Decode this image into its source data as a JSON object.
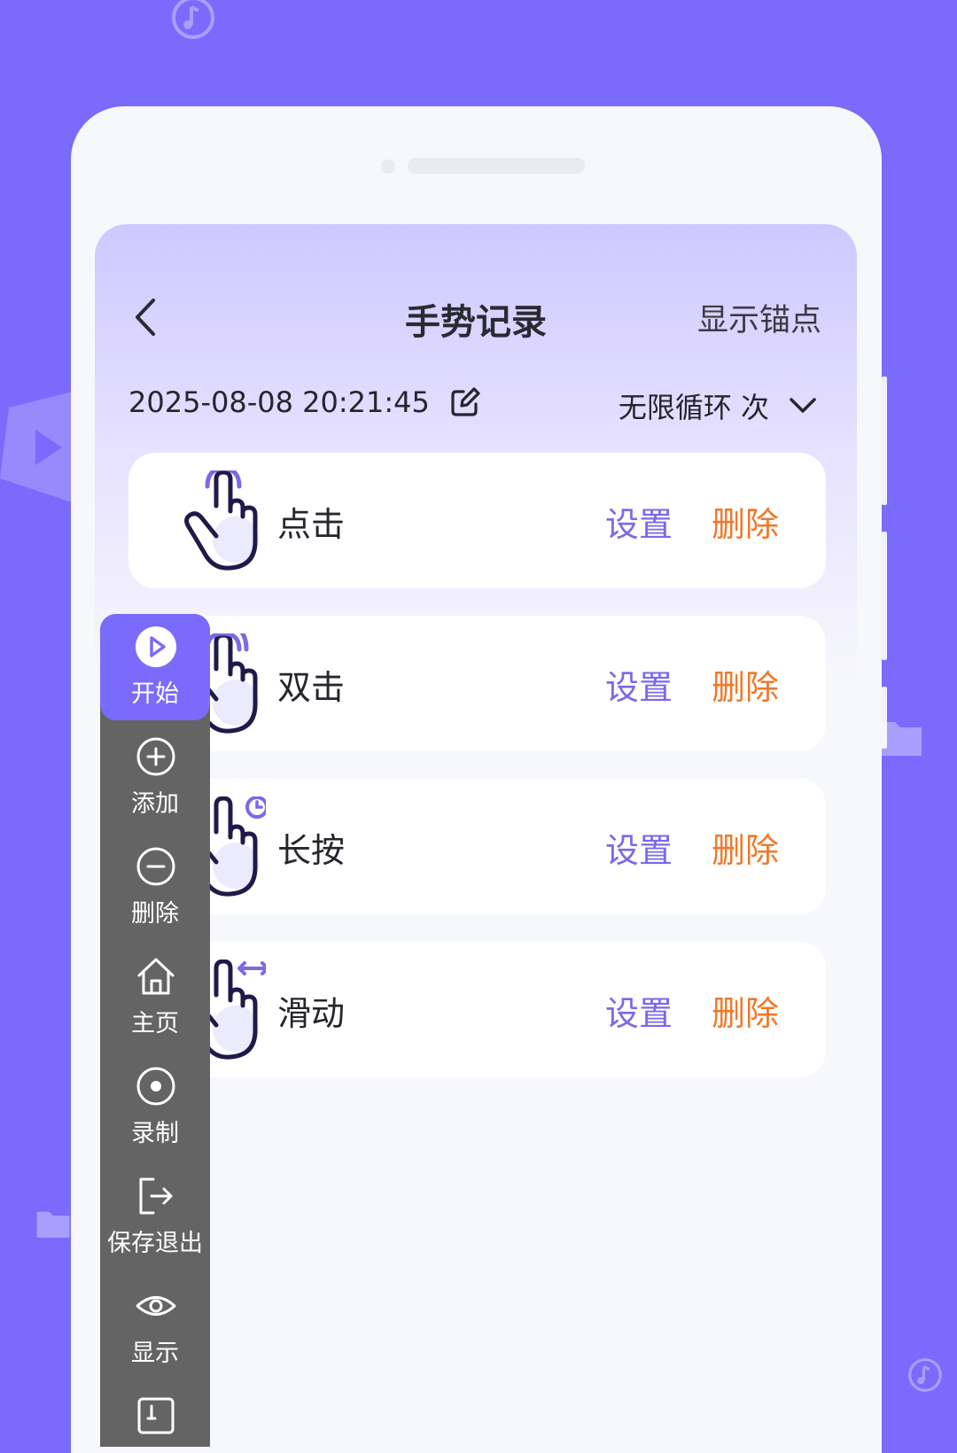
{
  "header": {
    "title": "手势记录",
    "right_action": "显示锚点"
  },
  "recording": {
    "datetime": "2025-08-08 20:21:45",
    "loop_label": "无限循环 次"
  },
  "gestures": [
    {
      "label": "点击",
      "set": "设置",
      "delete": "删除"
    },
    {
      "label": "双击",
      "set": "设置",
      "delete": "删除"
    },
    {
      "label": "长按",
      "set": "设置",
      "delete": "删除"
    },
    {
      "label": "滑动",
      "set": "设置",
      "delete": "删除"
    }
  ],
  "toolbar": {
    "items": [
      {
        "label": "开始",
        "icon": "play-icon"
      },
      {
        "label": "添加",
        "icon": "plus-icon"
      },
      {
        "label": "删除",
        "icon": "minus-icon"
      },
      {
        "label": "主页",
        "icon": "home-icon"
      },
      {
        "label": "录制",
        "icon": "record-icon"
      },
      {
        "label": "保存退出",
        "icon": "exit-icon"
      },
      {
        "label": "显示",
        "icon": "eye-icon"
      },
      {
        "label": "",
        "icon": "resize-icon"
      }
    ]
  },
  "colors": {
    "background": "#7a6bfd",
    "accent": "#7a69e8",
    "delete": "#f0782a",
    "toolbar": "#646464"
  }
}
